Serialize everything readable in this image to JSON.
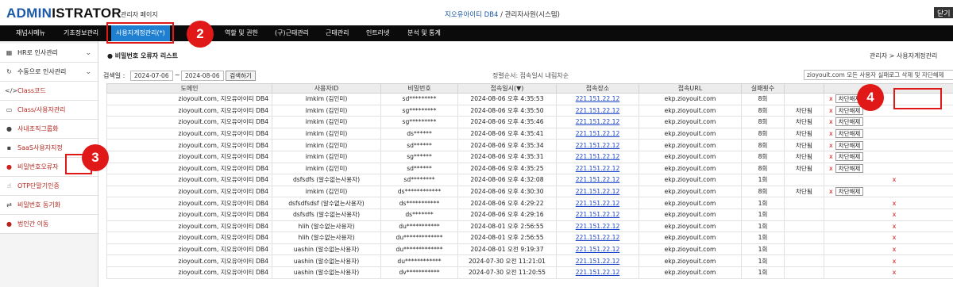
{
  "header": {
    "logo_a": "ADMIN",
    "logo_b": "ISTRATOR",
    "logo_sub": "관리자 페이지",
    "org": "지오유아이티 DB4",
    "sep": " / ",
    "user": "관리자사원(시스템)",
    "right_btn": "닫기"
  },
  "nav": [
    "재넘사메뉴",
    "기초정보관리",
    "사용자계정관리(*)",
    "역할 및 권한",
    "(구)근태관리",
    "근태관리",
    "인트라넷",
    "분석 및 통계"
  ],
  "badges": [
    "2",
    "3",
    "4"
  ],
  "sidebar": [
    {
      "label": "HR로 인사관리",
      "icon": "hr-icon",
      "chev": "⌄",
      "red": false
    },
    {
      "label": "수동으로 인사관리",
      "icon": "refresh-icon",
      "chev": "⌄",
      "red": false
    },
    {
      "label": "Class코드",
      "icon": "code-icon",
      "chev": "",
      "red": true
    },
    {
      "label": "Class/사용자관리",
      "icon": "folder-icon",
      "chev": "",
      "red": true
    },
    {
      "label": "사내조직그룹화",
      "icon": "chat-icon",
      "chev": "",
      "red": true
    },
    {
      "label": "SaaS사용자지정",
      "icon": "users-icon",
      "chev": "",
      "red": true
    },
    {
      "label": "비밀번호오류자",
      "icon": "alert-icon",
      "chev": "",
      "red": true
    },
    {
      "label": "OTP단말기인증",
      "icon": "hand-icon",
      "chev": "",
      "red": true
    },
    {
      "label": "비밀번호 동기화",
      "icon": "sync-icon",
      "chev": "",
      "red": true
    },
    {
      "label": "법인간 이동",
      "icon": "move-icon",
      "chev": "",
      "red": true
    }
  ],
  "page": {
    "title": "비밀번호 오류자 리스트",
    "breadcrumb": "관리자 > 사용자계정관리",
    "search_label": "검색일 :",
    "date_from": "2024-07-06",
    "date_sep": "~",
    "date_to": "2024-08-06",
    "search_btn": "검색하기",
    "sort_info": "정렬순서: 접속일시 내림차순",
    "right_search": "zioyouit.com 모든 사용자 실패로그 삭제 및 자단해제"
  },
  "table": {
    "headers": [
      "도메인",
      "사용자ID",
      "비밀번호",
      "접속일시(▼)",
      "접속장소",
      "접속URL",
      "실패횟수",
      "",
      ""
    ],
    "rows": [
      {
        "domain": "zioyouit.com, 지오유아이티 DB4",
        "uid": "imkim (김인미)",
        "pw": "sd*********",
        "dt": "2024-08-06 오후 4:35:53",
        "ip": "221.151.22.12",
        "url": "ekp.zioyouit.com",
        "cnt": "8회",
        "status": "",
        "action": "button"
      },
      {
        "domain": "zioyouit.com, 지오유아이티 DB4",
        "uid": "imkim (김인미)",
        "pw": "sg*********",
        "dt": "2024-08-06 오후 4:35:50",
        "ip": "221.151.22.12",
        "url": "ekp.zioyouit.com",
        "cnt": "8회",
        "status": "차단됨",
        "action": "button"
      },
      {
        "domain": "zioyouit.com, 지오유아이티 DB4",
        "uid": "imkim (김인미)",
        "pw": "sg*********",
        "dt": "2024-08-06 오후 4:35:46",
        "ip": "221.151.22.12",
        "url": "ekp.zioyouit.com",
        "cnt": "8회",
        "status": "차단됨",
        "action": "button"
      },
      {
        "domain": "zioyouit.com, 지오유아이티 DB4",
        "uid": "imkim (김인미)",
        "pw": "ds******",
        "dt": "2024-08-06 오후 4:35:41",
        "ip": "221.151.22.12",
        "url": "ekp.zioyouit.com",
        "cnt": "8회",
        "status": "차단됨",
        "action": "button"
      },
      {
        "domain": "zioyouit.com, 지오유아이티 DB4",
        "uid": "imkim (김인미)",
        "pw": "sd******",
        "dt": "2024-08-06 오후 4:35:34",
        "ip": "221.151.22.12",
        "url": "ekp.zioyouit.com",
        "cnt": "8회",
        "status": "차단됨",
        "action": "button"
      },
      {
        "domain": "zioyouit.com, 지오유아이티 DB4",
        "uid": "imkim (김인미)",
        "pw": "sg******",
        "dt": "2024-08-06 오후 4:35:31",
        "ip": "221.151.22.12",
        "url": "ekp.zioyouit.com",
        "cnt": "8회",
        "status": "차단됨",
        "action": "button"
      },
      {
        "domain": "zioyouit.com, 지오유아이티 DB4",
        "uid": "imkim (김인미)",
        "pw": "sd******",
        "dt": "2024-08-06 오후 4:35:25",
        "ip": "221.151.22.12",
        "url": "ekp.zioyouit.com",
        "cnt": "8회",
        "status": "차단됨",
        "action": "button"
      },
      {
        "domain": "zioyouit.com, 지오유아이티 DB4",
        "uid": "dsfsdfs (알수없는사용자)",
        "pw": "sd********",
        "dt": "2024-08-06 오후 4:32:08",
        "ip": "221.151.22.12",
        "url": "ekp.zioyouit.com",
        "cnt": "1회",
        "status": "",
        "action": "x"
      },
      {
        "domain": "zioyouit.com, 지오유아이티 DB4",
        "uid": "imkim (김인미)",
        "pw": "ds************",
        "dt": "2024-08-06 오후 4:30:30",
        "ip": "221.151.22.12",
        "url": "ekp.zioyouit.com",
        "cnt": "8회",
        "status": "차단됨",
        "action": "button"
      },
      {
        "domain": "zioyouit.com, 지오유아이티 DB4",
        "uid": "dsfsdfsdsf (알수없는사용자)",
        "pw": "ds***********",
        "dt": "2024-08-06 오후 4:29:22",
        "ip": "221.151.22.12",
        "url": "ekp.zioyouit.com",
        "cnt": "1회",
        "status": "",
        "action": "x"
      },
      {
        "domain": "zioyouit.com, 지오유아이티 DB4",
        "uid": "dsfsdfs (알수없는사용자)",
        "pw": "ds*******",
        "dt": "2024-08-06 오후 4:29:16",
        "ip": "221.151.22.12",
        "url": "ekp.zioyouit.com",
        "cnt": "1회",
        "status": "",
        "action": "x"
      },
      {
        "domain": "zioyouit.com, 지오유아이티 DB4",
        "uid": "hlih (알수없는사용자)",
        "pw": "du***********",
        "dt": "2024-08-01 오후 2:56:55",
        "ip": "221.151.22.12",
        "url": "ekp.zioyouit.com",
        "cnt": "1회",
        "status": "",
        "action": "x"
      },
      {
        "domain": "zioyouit.com, 지오유아이티 DB4",
        "uid": "hlih (알수없는사용자)",
        "pw": "du*************",
        "dt": "2024-08-01 오후 2:56:55",
        "ip": "221.151.22.12",
        "url": "ekp.zioyouit.com",
        "cnt": "1회",
        "status": "",
        "action": "x"
      },
      {
        "domain": "zioyouit.com, 지오유아이티 DB4",
        "uid": "uashin (알수없는사용자)",
        "pw": "du*************",
        "dt": "2024-08-01 오전 9:19:37",
        "ip": "221.151.22.12",
        "url": "ekp.zioyouit.com",
        "cnt": "1회",
        "status": "",
        "action": "x"
      },
      {
        "domain": "zioyouit.com, 지오유아이티 DB4",
        "uid": "uashin (알수없는사용자)",
        "pw": "du************",
        "dt": "2024-07-30 오전 11:21:01",
        "ip": "221.151.22.12",
        "url": "ekp.zioyouit.com",
        "cnt": "1회",
        "status": "",
        "action": "x"
      },
      {
        "domain": "zioyouit.com, 지오유아이티 DB4",
        "uid": "uashin (알수없는사용자)",
        "pw": "dv***********",
        "dt": "2024-07-30 오전 11:20:55",
        "ip": "221.151.22.12",
        "url": "ekp.zioyouit.com",
        "cnt": "1회",
        "status": "",
        "action": "x"
      }
    ],
    "x_label": "x",
    "unblock_label": "차단해제"
  }
}
